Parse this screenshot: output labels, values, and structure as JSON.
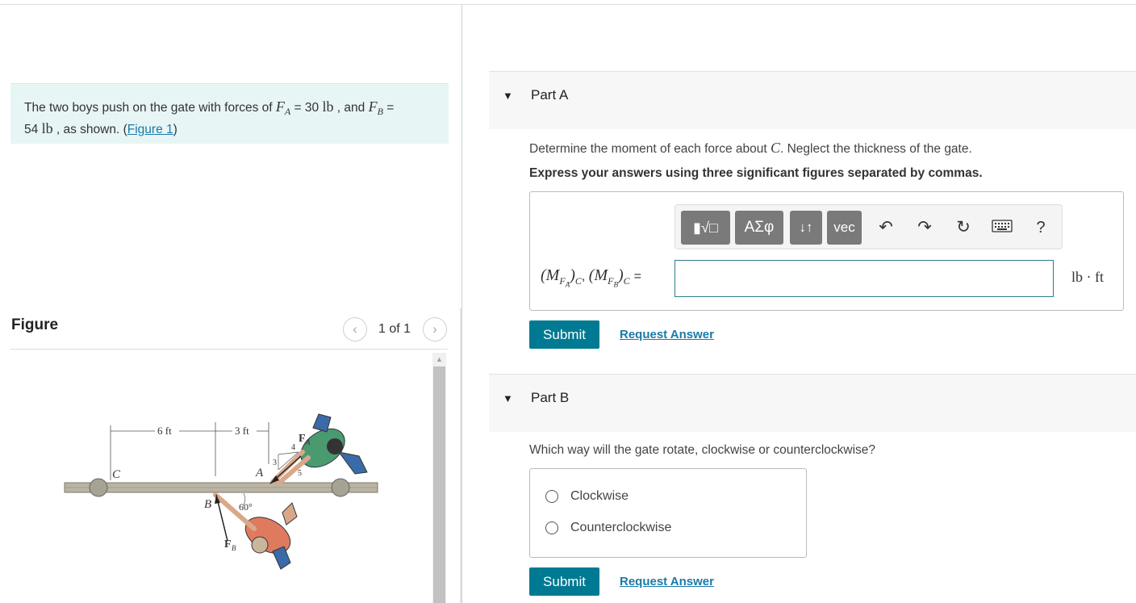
{
  "intro": {
    "text_before": "The two boys push on the gate with forces of ",
    "fa_symbol": "F",
    "fa_sub": "A",
    "fa_eq": " = 30 ",
    "fa_unit": "lb",
    "mid": " , and ",
    "fb_symbol": "F",
    "fb_sub": "B",
    "fb_eq": " =",
    "fb_value": "54 ",
    "fb_unit": "lb",
    "text_after": " , as shown. (",
    "figure_link": "Figure 1",
    "close_paren": ")"
  },
  "figure": {
    "heading": "Figure",
    "prev_icon": "chevron-left-icon",
    "next_icon": "chevron-right-icon",
    "count": "1 of 1",
    "labels": {
      "dim_left": "6 ft",
      "dim_right": "3 ft",
      "point_c": "C",
      "point_a": "A",
      "point_b": "B",
      "force_a": "F",
      "force_a_sub": "A",
      "force_b": "F",
      "force_b_sub": "B",
      "angle": "60°",
      "slope_3": "3",
      "slope_4": "4",
      "slope_5": "5"
    }
  },
  "part_a": {
    "title": "Part A",
    "question_before": "Determine the moment of each force about ",
    "question_var": "C",
    "question_after": ". Neglect the thickness of the gate.",
    "instruction": "Express your answers using three significant figures separated by commas.",
    "toolbar": {
      "template_icon": "template-icon",
      "greek_label": "ΑΣφ",
      "arrows_label": "↓↑",
      "vec_label": "vec",
      "undo_icon": "undo-icon",
      "redo_icon": "redo-icon",
      "reset_icon": "reset-icon",
      "keyboard_icon": "keyboard-icon",
      "help_label": "?"
    },
    "equation": {
      "m1": "M",
      "f1": "F",
      "f1_sub": "A",
      "c1": "C",
      "m2": "M",
      "f2": "F",
      "f2_sub": "B",
      "c2": "C",
      "equals": "="
    },
    "answer_value": "",
    "units": "lb · ft",
    "submit_label": "Submit",
    "request_label": "Request Answer"
  },
  "part_b": {
    "title": "Part B",
    "question": "Which way will the gate rotate, clockwise or counterclockwise?",
    "options": [
      "Clockwise",
      "Counterclockwise"
    ],
    "submit_label": "Submit",
    "request_label": "Request Answer"
  },
  "colors": {
    "accent": "#007a93",
    "link": "#1a7aa8",
    "intro_bg": "#e8f5f5"
  }
}
